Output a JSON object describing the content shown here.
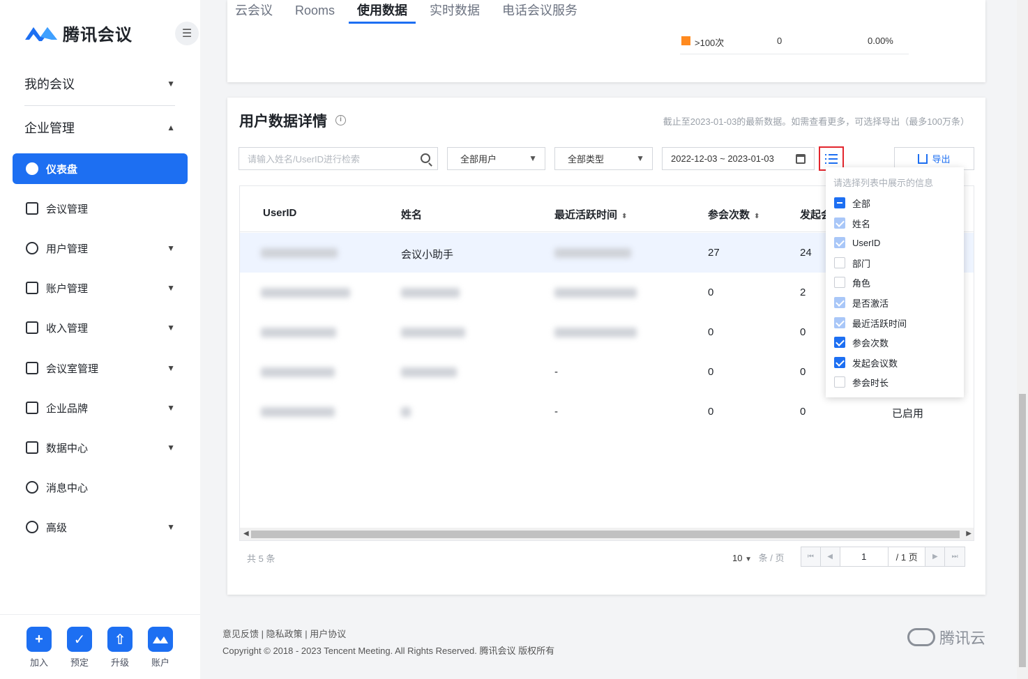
{
  "brand": {
    "name": "腾讯会议",
    "color": "#1d6ff2"
  },
  "sidebar": {
    "top": [
      {
        "label": "我的会议",
        "expanded": false
      },
      {
        "label": "企业管理",
        "expanded": true
      }
    ],
    "items": [
      {
        "label": "仪表盘",
        "icon": "dashboard-icon",
        "active": true
      },
      {
        "label": "会议管理",
        "icon": "list-icon"
      },
      {
        "label": "用户管理",
        "icon": "user-icon",
        "expandable": true
      },
      {
        "label": "账户管理",
        "icon": "wallet-icon",
        "expandable": true
      },
      {
        "label": "收入管理",
        "icon": "income-icon",
        "expandable": true
      },
      {
        "label": "会议室管理",
        "icon": "room-icon",
        "expandable": true
      },
      {
        "label": "企业品牌",
        "icon": "building-icon",
        "expandable": true
      },
      {
        "label": "数据中心",
        "icon": "chart-icon",
        "expandable": true
      },
      {
        "label": "消息中心",
        "icon": "bell-icon"
      },
      {
        "label": "高级",
        "icon": "shield-icon",
        "expandable": true
      }
    ],
    "quick_actions": [
      {
        "label": "加入",
        "icon": "plus-icon"
      },
      {
        "label": "预定",
        "icon": "calendar-icon"
      },
      {
        "label": "升级",
        "icon": "cart-icon"
      },
      {
        "label": "账户",
        "icon": "account-icon"
      }
    ]
  },
  "tabs": [
    {
      "label": "云会议",
      "active": false
    },
    {
      "label": "Rooms",
      "active": false
    },
    {
      "label": "使用数据",
      "active": true
    },
    {
      "label": "实时数据",
      "active": false
    },
    {
      "label": "电话会议服务",
      "active": false
    }
  ],
  "legend_row": {
    "label": ">100次",
    "count": "0",
    "percent": "0.00%",
    "color": "#ff8a1f"
  },
  "section": {
    "title": "用户数据详情",
    "hint": "截止至2023-01-03的最新数据。如需查看更多，可选择导出（最多100万条）"
  },
  "filters": {
    "search_placeholder": "请输入姓名/UserID进行检索",
    "user_select": "全部用户",
    "type_select": "全部类型",
    "date_range": "2022-12-03 ~ 2023-01-03",
    "export_label": "导出"
  },
  "table": {
    "columns": [
      "UserID",
      "姓名",
      "最近活跃时间",
      "参会次数",
      "发起会"
    ],
    "rows": [
      {
        "name": "会议小助手",
        "last_active": "",
        "attend": "27",
        "hosted": "24",
        "status": ""
      },
      {
        "name": "",
        "last_active": "",
        "attend": "0",
        "hosted": "2",
        "status": ""
      },
      {
        "name": "",
        "last_active": "",
        "attend": "0",
        "hosted": "0",
        "status": ""
      },
      {
        "name": "",
        "last_active": "-",
        "attend": "0",
        "hosted": "0",
        "status": ""
      },
      {
        "name": "",
        "last_active": "-",
        "attend": "0",
        "hosted": "0",
        "status": "已启用"
      }
    ]
  },
  "pagination": {
    "total": "共 5 条",
    "page_size": "10",
    "page_size_unit": "条 / 页",
    "current_page": "1",
    "total_pages": "/ 1 页"
  },
  "column_picker": {
    "title": "请选择列表中展示的信息",
    "options": [
      {
        "label": "全部",
        "state": "indeterminate"
      },
      {
        "label": "姓名",
        "state": "disabled"
      },
      {
        "label": "UserID",
        "state": "disabled"
      },
      {
        "label": "部门",
        "state": "unchecked"
      },
      {
        "label": "角色",
        "state": "unchecked"
      },
      {
        "label": "是否激活",
        "state": "disabled"
      },
      {
        "label": "最近活跃时间",
        "state": "disabled"
      },
      {
        "label": "参会次数",
        "state": "checked"
      },
      {
        "label": "发起会议数",
        "state": "checked"
      },
      {
        "label": "参会时长",
        "state": "unchecked"
      }
    ]
  },
  "footer": {
    "links": "意见反馈 | 隐私政策 | 用户协议",
    "copyright": "Copyright © 2018 - 2023 Tencent Meeting. All Rights Reserved. 腾讯会议 版权所有",
    "brand": "腾讯云"
  }
}
